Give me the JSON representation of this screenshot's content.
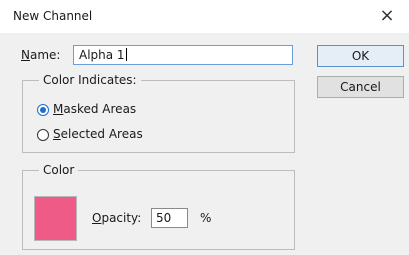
{
  "dialog": {
    "title": "New Channel",
    "close_glyph": "×"
  },
  "name_field": {
    "label_mnemonic": "N",
    "label_rest": "ame:",
    "value": "Alpha 1"
  },
  "buttons": {
    "ok": "OK",
    "cancel": "Cancel"
  },
  "color_indicates": {
    "legend": "Color Indicates:",
    "options": [
      {
        "mnemonic": "M",
        "rest": "asked Areas",
        "selected": true
      },
      {
        "mnemonic": "S",
        "rest": "elected Areas",
        "selected": false
      }
    ]
  },
  "color_group": {
    "legend": "Color",
    "swatch_color": "#ed5b86",
    "opacity_label_mnemonic": "O",
    "opacity_label_rest": "pacity:",
    "opacity_value": "50",
    "opacity_unit": "%"
  }
}
